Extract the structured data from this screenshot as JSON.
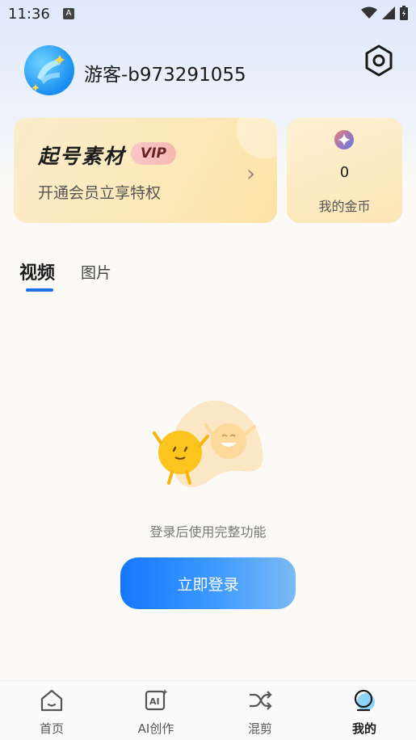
{
  "status_bar": {
    "time": "11:36",
    "notif_letter": "A"
  },
  "header": {
    "username": "游客-b973291055"
  },
  "vip_card": {
    "title": "起号素材",
    "badge": "VIP",
    "subtitle": "开通会员立享特权",
    "chevron": "›"
  },
  "coin_card": {
    "value": "0",
    "label": "我的金币"
  },
  "tabs": [
    {
      "label": "视频",
      "active": true
    },
    {
      "label": "图片",
      "active": false
    }
  ],
  "empty_state": {
    "message": "登录后使用完整功能",
    "button": "立即登录"
  },
  "bottom_nav": [
    {
      "label": "首页",
      "icon": "home-icon",
      "active": false
    },
    {
      "label": "AI创作",
      "icon": "ai-create-icon",
      "active": false
    },
    {
      "label": "混剪",
      "icon": "shuffle-icon",
      "active": false
    },
    {
      "label": "我的",
      "icon": "profile-icon",
      "active": true
    }
  ],
  "colors": {
    "accent": "#1f6fe8",
    "button_start": "#1477ff",
    "vip_bg": "#fde9b8"
  }
}
